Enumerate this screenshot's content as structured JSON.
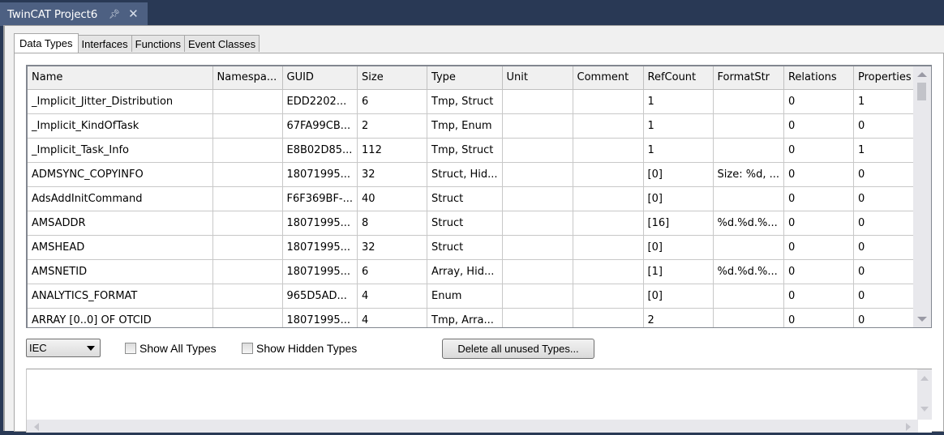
{
  "document_tab": {
    "title": "TwinCAT Project6",
    "pin_icon": "pin-icon",
    "close_icon": "close-icon"
  },
  "tabs": [
    {
      "label": "Data Types",
      "active": true
    },
    {
      "label": "Interfaces",
      "active": false
    },
    {
      "label": "Functions",
      "active": false
    },
    {
      "label": "Event Classes",
      "active": false
    }
  ],
  "grid": {
    "columns": [
      "Name",
      "Namespa...",
      "GUID",
      "Size",
      "Type",
      "Unit",
      "Comment",
      "RefCount",
      "FormatStr",
      "Relations",
      "Properties"
    ],
    "rows": [
      [
        "_Implicit_Jitter_Distribution",
        "",
        "EDD2202...",
        "6",
        "Tmp, Struct",
        "",
        "",
        "1",
        "",
        "0",
        "1"
      ],
      [
        "_Implicit_KindOfTask",
        "",
        "67FA99CB...",
        "2",
        "Tmp, Enum",
        "",
        "",
        "1",
        "",
        "0",
        "0"
      ],
      [
        "_Implicit_Task_Info",
        "",
        "E8B02D85...",
        "112",
        "Tmp, Struct",
        "",
        "",
        "1",
        "",
        "0",
        "1"
      ],
      [
        "ADMSYNC_COPYINFO",
        "",
        "18071995...",
        "32",
        "Struct, Hid...",
        "",
        "",
        "[0]",
        "Size: %d, ...",
        "0",
        "0"
      ],
      [
        "AdsAddInitCommand",
        "",
        "F6F369BF-...",
        "40",
        "Struct",
        "",
        "",
        "[0]",
        "",
        "0",
        "0"
      ],
      [
        "AMSADDR",
        "",
        "18071995...",
        "8",
        "Struct",
        "",
        "",
        "[16]",
        "%d.%d.%...",
        "0",
        "0"
      ],
      [
        "AMSHEAD",
        "",
        "18071995...",
        "32",
        "Struct",
        "",
        "",
        "[0]",
        "",
        "0",
        "0"
      ],
      [
        "AMSNETID",
        "",
        "18071995...",
        "6",
        "Array, Hid...",
        "",
        "",
        "[1]",
        "%d.%d.%...",
        "0",
        "0"
      ],
      [
        "ANALYTICS_FORMAT",
        "",
        "965D5AD...",
        "4",
        "Enum",
        "",
        "",
        "[0]",
        "",
        "0",
        "0"
      ],
      [
        "ARRAY [0..0] OF OTCID",
        "",
        "18071995...",
        "4",
        "Tmp, Arra...",
        "",
        "",
        "2",
        "",
        "0",
        "0"
      ]
    ]
  },
  "controls": {
    "format_combo": {
      "value": "IEC"
    },
    "show_all_types": {
      "label": "Show All Types",
      "checked": false
    },
    "show_hidden_types": {
      "label": "Show Hidden Types",
      "checked": false
    },
    "delete_unused_button": "Delete all unused Types..."
  }
}
